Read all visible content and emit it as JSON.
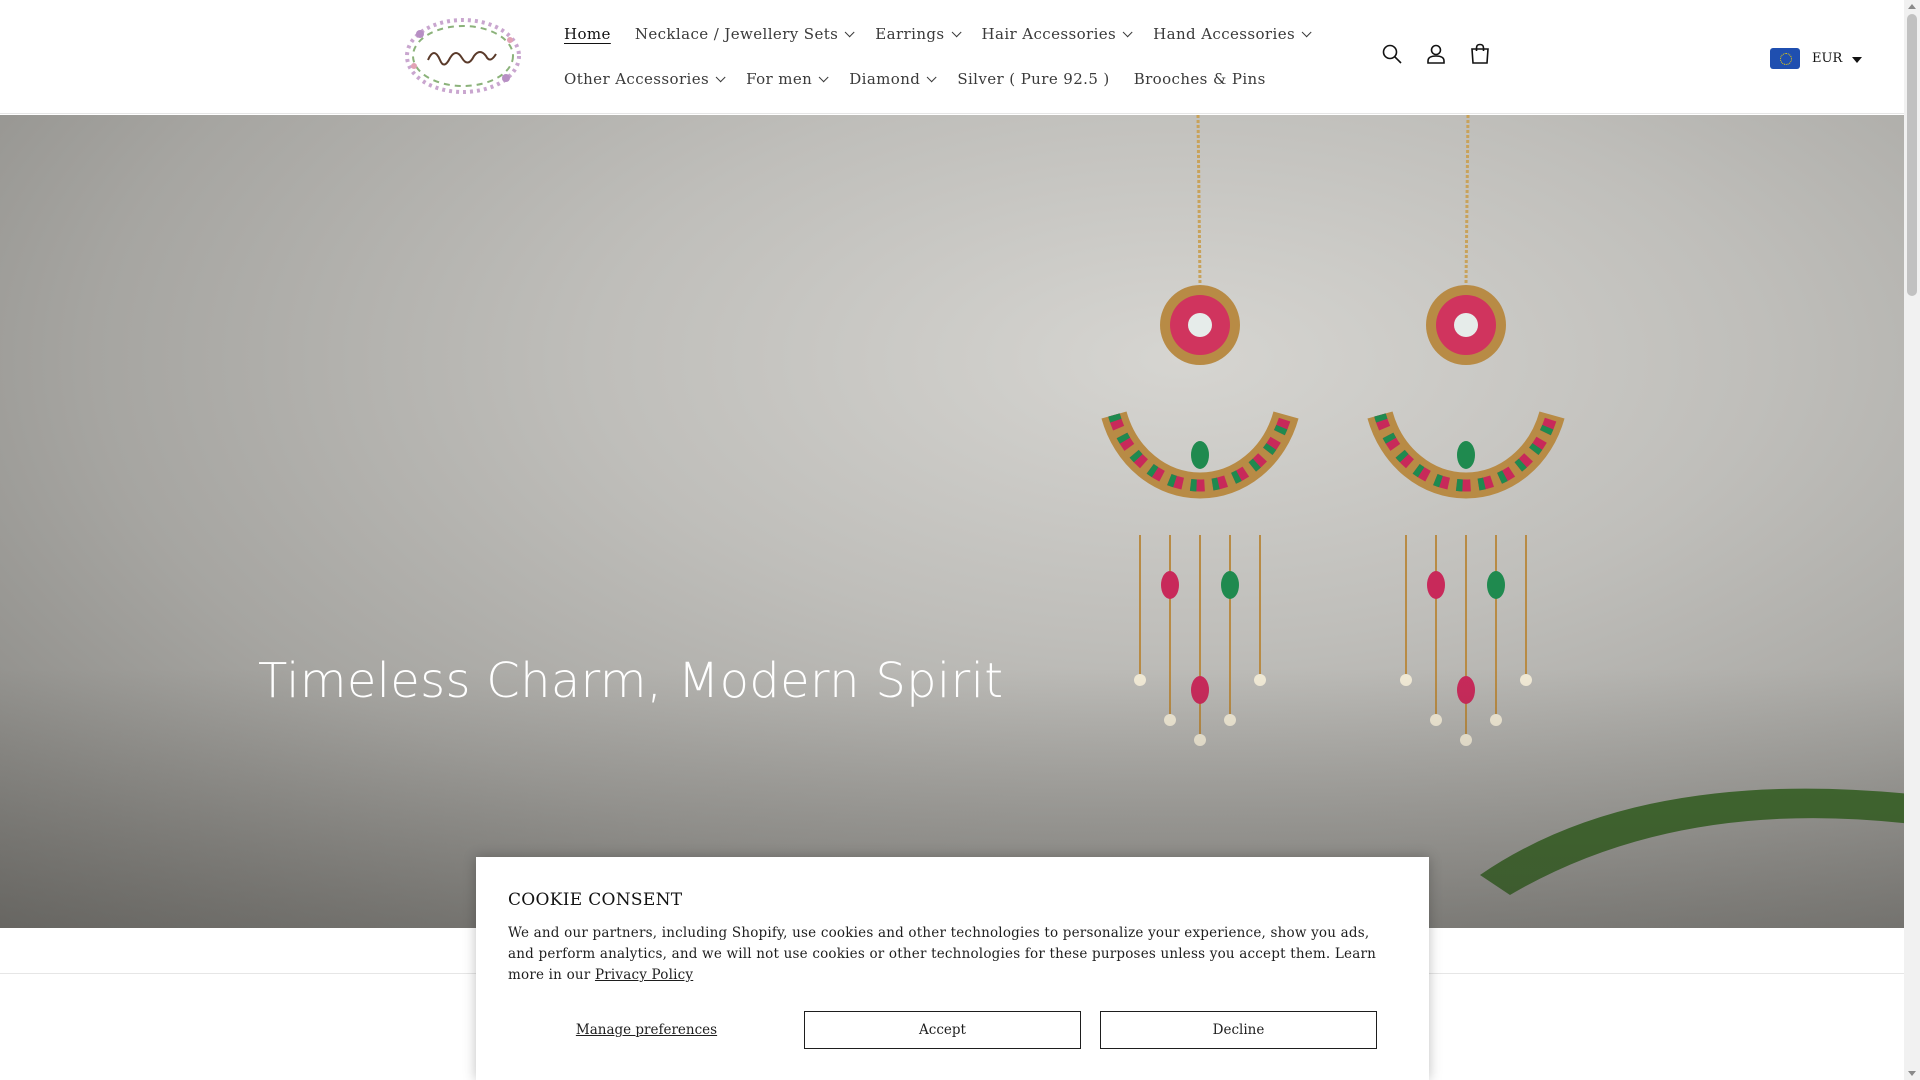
{
  "header": {
    "logo_alt": "Ranibaug",
    "nav_row1": [
      {
        "label": "Home",
        "active": true,
        "dropdown": false
      },
      {
        "label": "Necklace / Jewellery Sets",
        "dropdown": true
      },
      {
        "label": "Earrings",
        "dropdown": true
      },
      {
        "label": "Hair Accessories",
        "dropdown": true
      },
      {
        "label": "Hand Accessories",
        "dropdown": true
      }
    ],
    "nav_row2": [
      {
        "label": "Other Accessories",
        "dropdown": true
      },
      {
        "label": "For men",
        "dropdown": true
      },
      {
        "label": "Diamond",
        "dropdown": true
      },
      {
        "label": "Silver ( Pure 92.5 )",
        "dropdown": false
      },
      {
        "label": "Brooches & Pins",
        "dropdown": false
      }
    ],
    "icons": [
      "search-icon",
      "account-icon",
      "cart-icon"
    ],
    "currency": {
      "code": "EUR",
      "flag": "eu-flag-icon"
    }
  },
  "hero": {
    "title": "Timeless Charm, Modern Spirit"
  },
  "cookie": {
    "title": "COOKIE CONSENT",
    "text": "We and our partners, including Shopify, use cookies and other technologies to personalize your experience, show you ads, and perform analytics, and we will not use cookies or other technologies for these purposes unless you accept them. Learn more in our",
    "policy_link": "Privacy Policy",
    "manage_label": "Manage preferences",
    "accept_label": "Accept",
    "decline_label": "Decline"
  },
  "colors": {
    "accent": "#121212",
    "flag_blue": "#1f4fb0",
    "flag_gold": "#f2d300"
  }
}
